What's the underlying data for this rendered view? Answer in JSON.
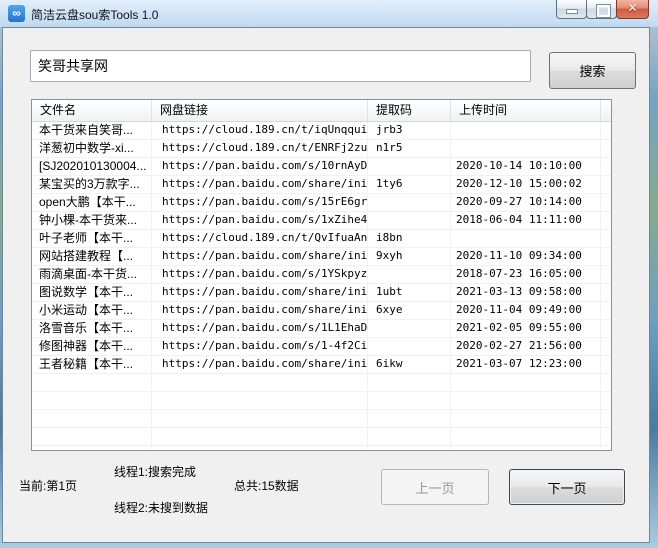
{
  "window": {
    "title": "简洁云盘sou索Tools 1.0",
    "app_icon_glyph": "∞",
    "close_glyph": "✕"
  },
  "search": {
    "value": "笑哥共享网",
    "button_label": "搜索"
  },
  "table": {
    "columns": [
      "文件名",
      "网盘链接",
      "提取码",
      "上传时间"
    ],
    "rows": [
      {
        "filename": "本干货来自笑哥...",
        "link": "https://cloud.189.cn/t/iqUnqqui...",
        "code": "jrb3",
        "time": ""
      },
      {
        "filename": "洋葱初中数学-xi...",
        "link": "https://cloud.189.cn/t/ENRFj2zu...",
        "code": "n1r5",
        "time": ""
      },
      {
        "filename": "[SJ202010130004...",
        "link": "https://pan.baidu.com/s/10rnAyD...",
        "code": "",
        "time": "2020-10-14 10:10:00"
      },
      {
        "filename": "某宝买的3万款字...",
        "link": "https://pan.baidu.com/share/ini...",
        "code": "1ty6",
        "time": "2020-12-10 15:00:02"
      },
      {
        "filename": "open大鹏【本干...",
        "link": "https://pan.baidu.com/s/15rE6gr...",
        "code": "",
        "time": "2020-09-27 10:14:00"
      },
      {
        "filename": "钟小棵-本干货来...",
        "link": "https://pan.baidu.com/s/1xZihe4...",
        "code": "",
        "time": "2018-06-04 11:11:00"
      },
      {
        "filename": "叶子老师【本干...",
        "link": "https://cloud.189.cn/t/QvIfuaAn...",
        "code": "i8bn",
        "time": ""
      },
      {
        "filename": "网站搭建教程【...",
        "link": "https://pan.baidu.com/share/ini...",
        "code": "9xyh",
        "time": "2020-11-10 09:34:00"
      },
      {
        "filename": "雨滴桌面-本干货...",
        "link": "https://pan.baidu.com/s/1YSkpyz...",
        "code": "",
        "time": "2018-07-23 16:05:00"
      },
      {
        "filename": "图说数学【本干...",
        "link": "https://pan.baidu.com/share/ini...",
        "code": "1ubt",
        "time": "2021-03-13 09:58:00"
      },
      {
        "filename": "小米运动【本干...",
        "link": "https://pan.baidu.com/share/ini...",
        "code": "6xye",
        "time": "2020-11-04 09:49:00"
      },
      {
        "filename": "洛雪音乐【本干...",
        "link": "https://pan.baidu.com/s/1L1EhaD...",
        "code": "",
        "time": "2021-02-05 09:55:00"
      },
      {
        "filename": "修图神器【本干...",
        "link": "https://pan.baidu.com/s/1-4f2Ci...",
        "code": "",
        "time": "2020-02-27 21:56:00"
      },
      {
        "filename": "王者秘籍【本干...",
        "link": "https://pan.baidu.com/share/ini...",
        "code": "6ikw",
        "time": "2021-03-07 12:23:00"
      }
    ],
    "empty_row_count": 7
  },
  "status": {
    "current_page": "当前:第1页",
    "thread1": "线程1:搜索完成",
    "thread2": "线程2:未搜到数据",
    "total": "总共:15数据"
  },
  "pagination": {
    "prev_label": "上一页",
    "next_label": "下一页"
  },
  "colors": {
    "titlebar_blue": "#cfe3f6",
    "close_button_red": "#cf5a40",
    "icon_blue": "#2472cd",
    "client_gray": "#f0f0f0"
  }
}
